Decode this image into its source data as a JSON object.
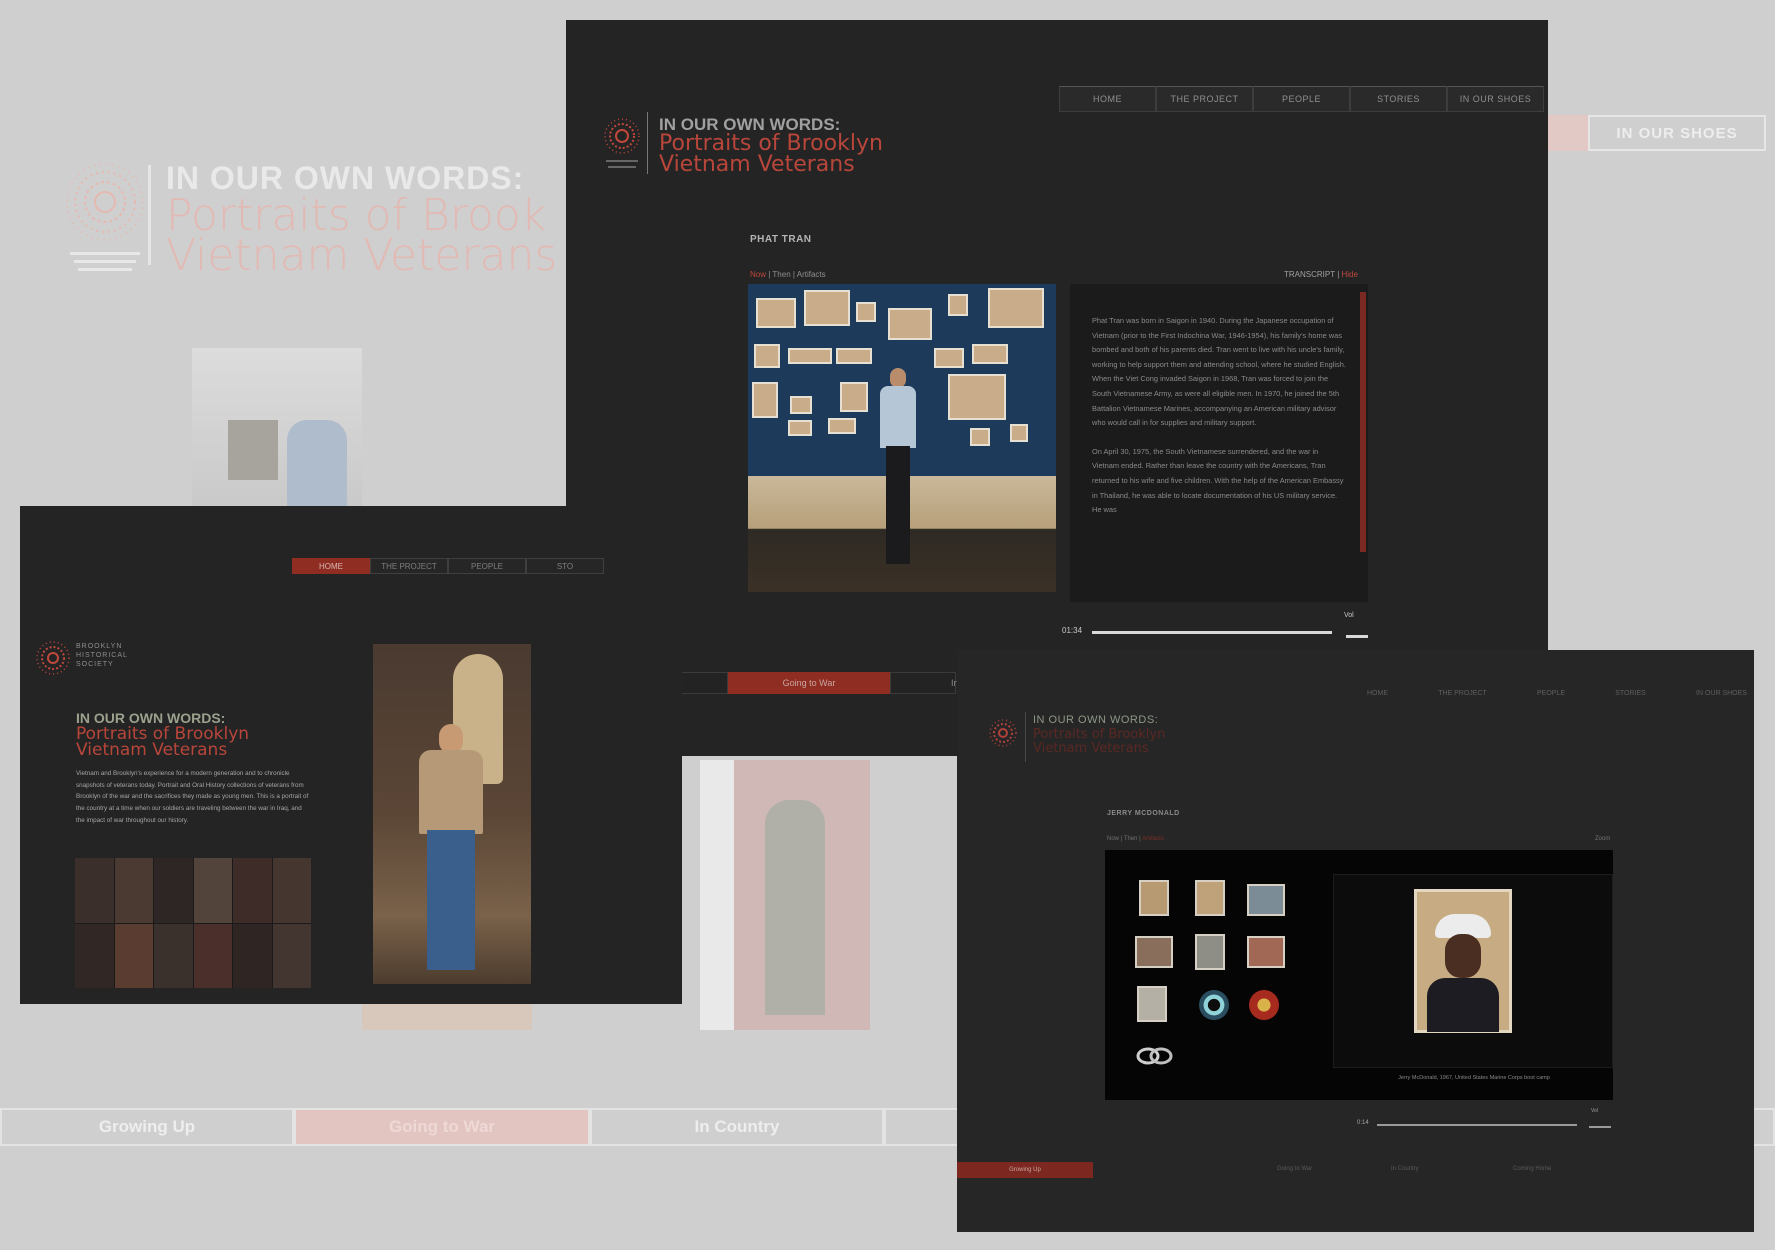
{
  "background": {
    "title": "IN OUR OWN WORDS:",
    "subtitle_line1": "Portraits of Brook",
    "subtitle_line2": "Vietnam Veterans",
    "shoes_tab": "IN OUR SHOES",
    "nav": [
      "Growing Up",
      "Going to War",
      "In Country",
      ""
    ]
  },
  "screenA": {
    "nav": [
      "HOME",
      "THE PROJECT",
      "PEOPLE",
      "STORIES",
      "IN OUR SHOES"
    ],
    "title": "IN OUR OWN WORDS:",
    "subtitle_line1": "Portraits of Brooklyn",
    "subtitle_line2": "Vietnam Veterans",
    "person_name": "PHAT TRAN",
    "tabs": [
      "Now",
      "Then",
      "Artifacts"
    ],
    "transcript_label": "TRANSCRIPT",
    "transcript_link": "Hide",
    "transcript_paragraphs": [
      "Phat Tran was born in Saigon in 1940. During the Japanese occupation of Vietnam (prior to the First Indochina War, 1946-1954), his family's home was bombed and both of his parents died. Tran went to live with his uncle's family, working to help support them and attending school, where he studied English. When the Viet Cong invaded Saigon in 1968, Tran was forced to join the South Vietnamese Army, as were all eligible men. In 1970, he joined the 5th Battalion Vietnamese Marines, accompanying an American military advisor who would call in for supplies and military support.",
      "On April 30, 1975, the South Vietnamese surrendered, and the war in Vietnam ended. Rather than leave the country with the Americans, Tran returned to his wife and five children. With the help of the American Embassy in Thailand, he was able to locate documentation of his US military service. He was"
    ],
    "time": "01:34",
    "volume_label": "Vol"
  },
  "stripA": [
    "Growing Up",
    "Going to War",
    "In"
  ],
  "screenB": {
    "nav": [
      "HOME",
      "THE PROJECT",
      "PEOPLE",
      "STO"
    ],
    "org_label": "BROOKLYN HISTORICAL SOCIETY",
    "title": "IN OUR OWN WORDS:",
    "subtitle_line1": "Portraits of Brooklyn",
    "subtitle_line2": "Vietnam Veterans",
    "intro": "Vietnam and Brooklyn's experience for a modern generation and to chronicle snapshots of veterans today. Portrait and Oral History collections of veterans from Brooklyn of the war and the sacrifices they made as young men. This is a portrait of the country at a time when our soldiers are traveling between the war in Iraq, and the impact of war throughout our history."
  },
  "screenC": {
    "nav": [
      "HOME",
      "THE PROJECT",
      "PEOPLE",
      "STORIES",
      "IN OUR SHOES"
    ],
    "title": "IN OUR OWN WORDS:",
    "subtitle_line1": "Portraits of Brooklyn",
    "subtitle_line2": "Vietnam Veterans",
    "person_name": "JERRY MCDONALD",
    "tabs": [
      "Now",
      "Then",
      "Artifacts"
    ],
    "zoom_label": "Zoom",
    "caption": "Jerry McDonald, 1967, United States Marine Corps boot camp",
    "time": "0:14",
    "volume_label": "Vol",
    "subnav": [
      "Growing Up",
      "Going to War",
      "In Country",
      "Coming Home"
    ]
  }
}
